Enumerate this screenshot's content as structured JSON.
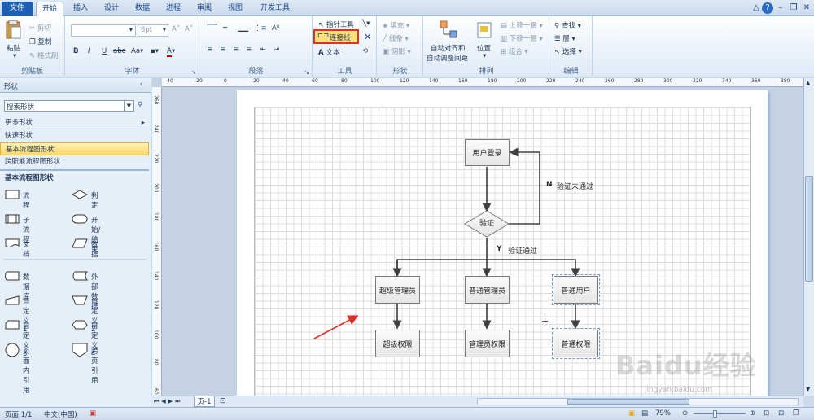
{
  "colors": {
    "accent": "#1d5fb0",
    "highlight": "#ffe07a",
    "red": "#e0302a"
  },
  "tabs": [
    "文件",
    "开始",
    "插入",
    "设计",
    "数据",
    "进程",
    "审阅",
    "视图",
    "开发工具"
  ],
  "ribbon": {
    "clipboard": {
      "paste": "粘贴",
      "cut": "剪切",
      "copy": "复制",
      "format_painter": "格式刷",
      "label": "剪贴板"
    },
    "font": {
      "font_size": "8pt",
      "bold": "B",
      "italic": "I",
      "underline": "U",
      "strike": "abc",
      "label": "字体"
    },
    "paragraph": {
      "label": "段落"
    },
    "tools": {
      "pointer": "指针工具",
      "connector": "连接线",
      "text": "文本",
      "label": "工具"
    },
    "shape": {
      "fill": "填充",
      "line": "线条",
      "shadow": "阴影",
      "label": "形状"
    },
    "arrange": {
      "auto_align": "自动对齐和",
      "auto_space": "自动调整间距",
      "position": "位置",
      "bring_forward": "上移一层",
      "send_backward": "下移一层",
      "group": "组合",
      "label": "排列"
    },
    "edit": {
      "find": "查找",
      "layers": "层",
      "select": "选择",
      "label": "编辑"
    }
  },
  "shapes_panel": {
    "title": "形状",
    "search_placeholder": "搜索形状",
    "more": "更多形状",
    "quick": "快速形状",
    "basic": "基本流程图形状",
    "cross": "跨职能流程图形状",
    "section": "基本流程图形状",
    "items": [
      "流程",
      "判定",
      "子流程",
      "开始/结束",
      "文档",
      "数据",
      "数据库",
      "外部数据",
      "自定义 1",
      "自定义 2",
      "自定义 3",
      "自定义 4",
      "页面内引用",
      "跨页引用"
    ]
  },
  "ruler_h": [
    "-40",
    "-20",
    "0",
    "20",
    "40",
    "60",
    "80",
    "100",
    "120",
    "140",
    "160",
    "180",
    "200",
    "220",
    "240",
    "260",
    "280",
    "300",
    "320",
    "340",
    "360",
    "380"
  ],
  "ruler_v": [
    "260",
    "240",
    "220",
    "200",
    "180",
    "160",
    "140",
    "120",
    "100",
    "80",
    "60"
  ],
  "diagram": {
    "login": "用户登录",
    "verify": "验证",
    "n_label": "N",
    "n_text": "验证未通过",
    "y_label": "Y",
    "y_text": "验证通过",
    "super_admin": "超级管理员",
    "admin": "普通管理员",
    "user": "普通用户",
    "super_perm": "超级权限",
    "admin_perm": "管理员权限",
    "user_perm": "普通权限"
  },
  "page_tab": "页-1",
  "status": {
    "page": "页面 1/1",
    "lang": "中文(中国)",
    "zoom": "79%"
  },
  "watermark": {
    "brand": "Baidu经验",
    "url": "jingyan.baidu.com"
  }
}
